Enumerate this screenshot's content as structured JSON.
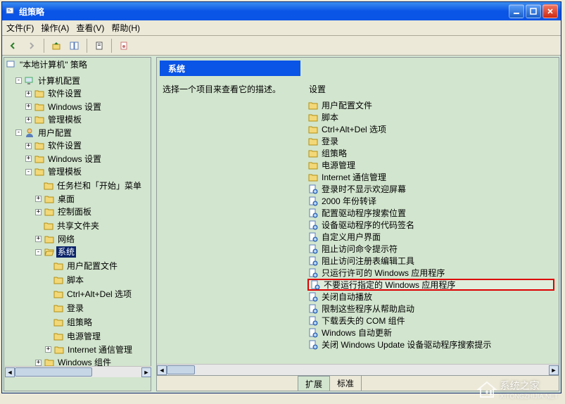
{
  "window": {
    "title": "组策略"
  },
  "menu": {
    "file": "文件(F)",
    "action": "操作(A)",
    "view": "查看(V)",
    "help": "帮助(H)"
  },
  "tree": {
    "root": "\"本地计算机\" 策略",
    "computer": "计算机配置",
    "software": "软件设置",
    "windows_settings": "Windows 设置",
    "admin_templates": "管理模板",
    "user": "用户配置",
    "taskbar": "任务栏和「开始」菜单",
    "desktop": "桌面",
    "control_panel": "控制面板",
    "shared_folders": "共享文件夹",
    "network": "网络",
    "system": "系统",
    "user_profiles": "用户配置文件",
    "scripts": "脚本",
    "ctrl_alt_del": "Ctrl+Alt+Del 选项",
    "logon": "登录",
    "group_policy": "组策略",
    "power_mgmt": "电源管理",
    "internet_comm": "Internet 通信管理",
    "windows_components": "Windows 组件"
  },
  "right_header": {
    "title": "系统"
  },
  "description": "选择一个项目来查看它的描述。",
  "settings_label": "设置",
  "settings_folders": [
    "用户配置文件",
    "脚本",
    "Ctrl+Alt+Del 选项",
    "登录",
    "组策略",
    "电源管理",
    "Internet 通信管理"
  ],
  "settings_items": [
    "登录时不显示欢迎屏幕",
    "2000 年份转译",
    "配置驱动程序搜索位置",
    "设备驱动程序的代码签名",
    "自定义用户界面",
    "阻止访问命令提示符",
    "阻止访问注册表编辑工具",
    "只运行许可的 Windows 应用程序",
    "不要运行指定的 Windows 应用程序",
    "关闭自动播放",
    "限制这些程序从帮助启动",
    "下载丢失的 COM 组件",
    "Windows 自动更新",
    "关闭 Windows Update 设备驱动程序搜索提示"
  ],
  "highlighted_index": 8,
  "tabs": {
    "extended": "扩展",
    "standard": "标准"
  },
  "watermark": {
    "text": "系统之家",
    "url": "XITONGZHIJIA.NET"
  }
}
